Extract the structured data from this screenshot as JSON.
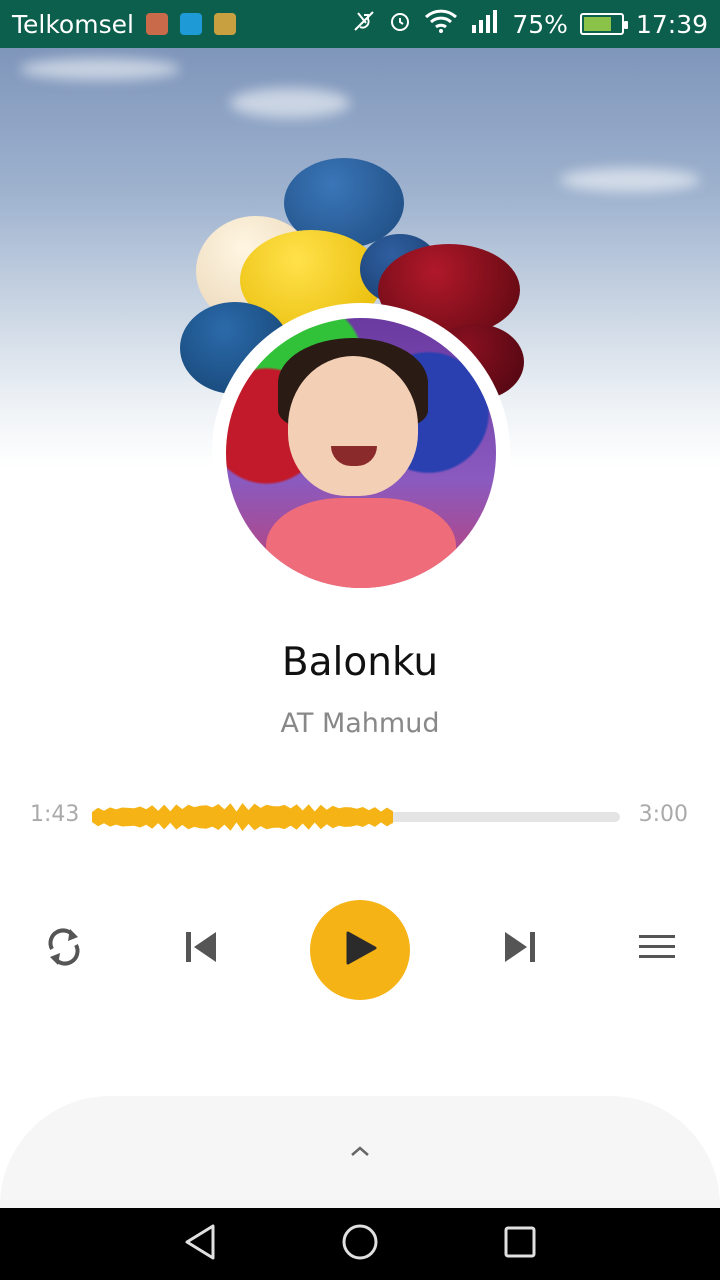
{
  "status_bar": {
    "carrier": "Telkomsel",
    "battery_percent": "75%",
    "time": "17:39",
    "battery_level": 0.75,
    "icons": [
      "app-notification-icon",
      "usb-icon",
      "game-notification-icon",
      "mute-icon",
      "alarm-icon",
      "wifi-icon",
      "signal-icon",
      "battery-charging-icon"
    ]
  },
  "player": {
    "title": "Balonku",
    "artist": "AT Mahmud",
    "elapsed": "1:43",
    "duration": "3:00",
    "progress": 0.57,
    "accent_color": "#f5b316"
  },
  "controls": {
    "repeat": "repeat-icon",
    "previous": "skip-previous-icon",
    "play": "play-icon",
    "next": "skip-next-icon",
    "queue": "queue-menu-icon"
  },
  "bottom_sheet": {
    "expand_icon": "chevron-up-icon"
  },
  "nav_bar": {
    "back": "back-icon",
    "home": "home-icon",
    "recents": "recents-icon"
  }
}
